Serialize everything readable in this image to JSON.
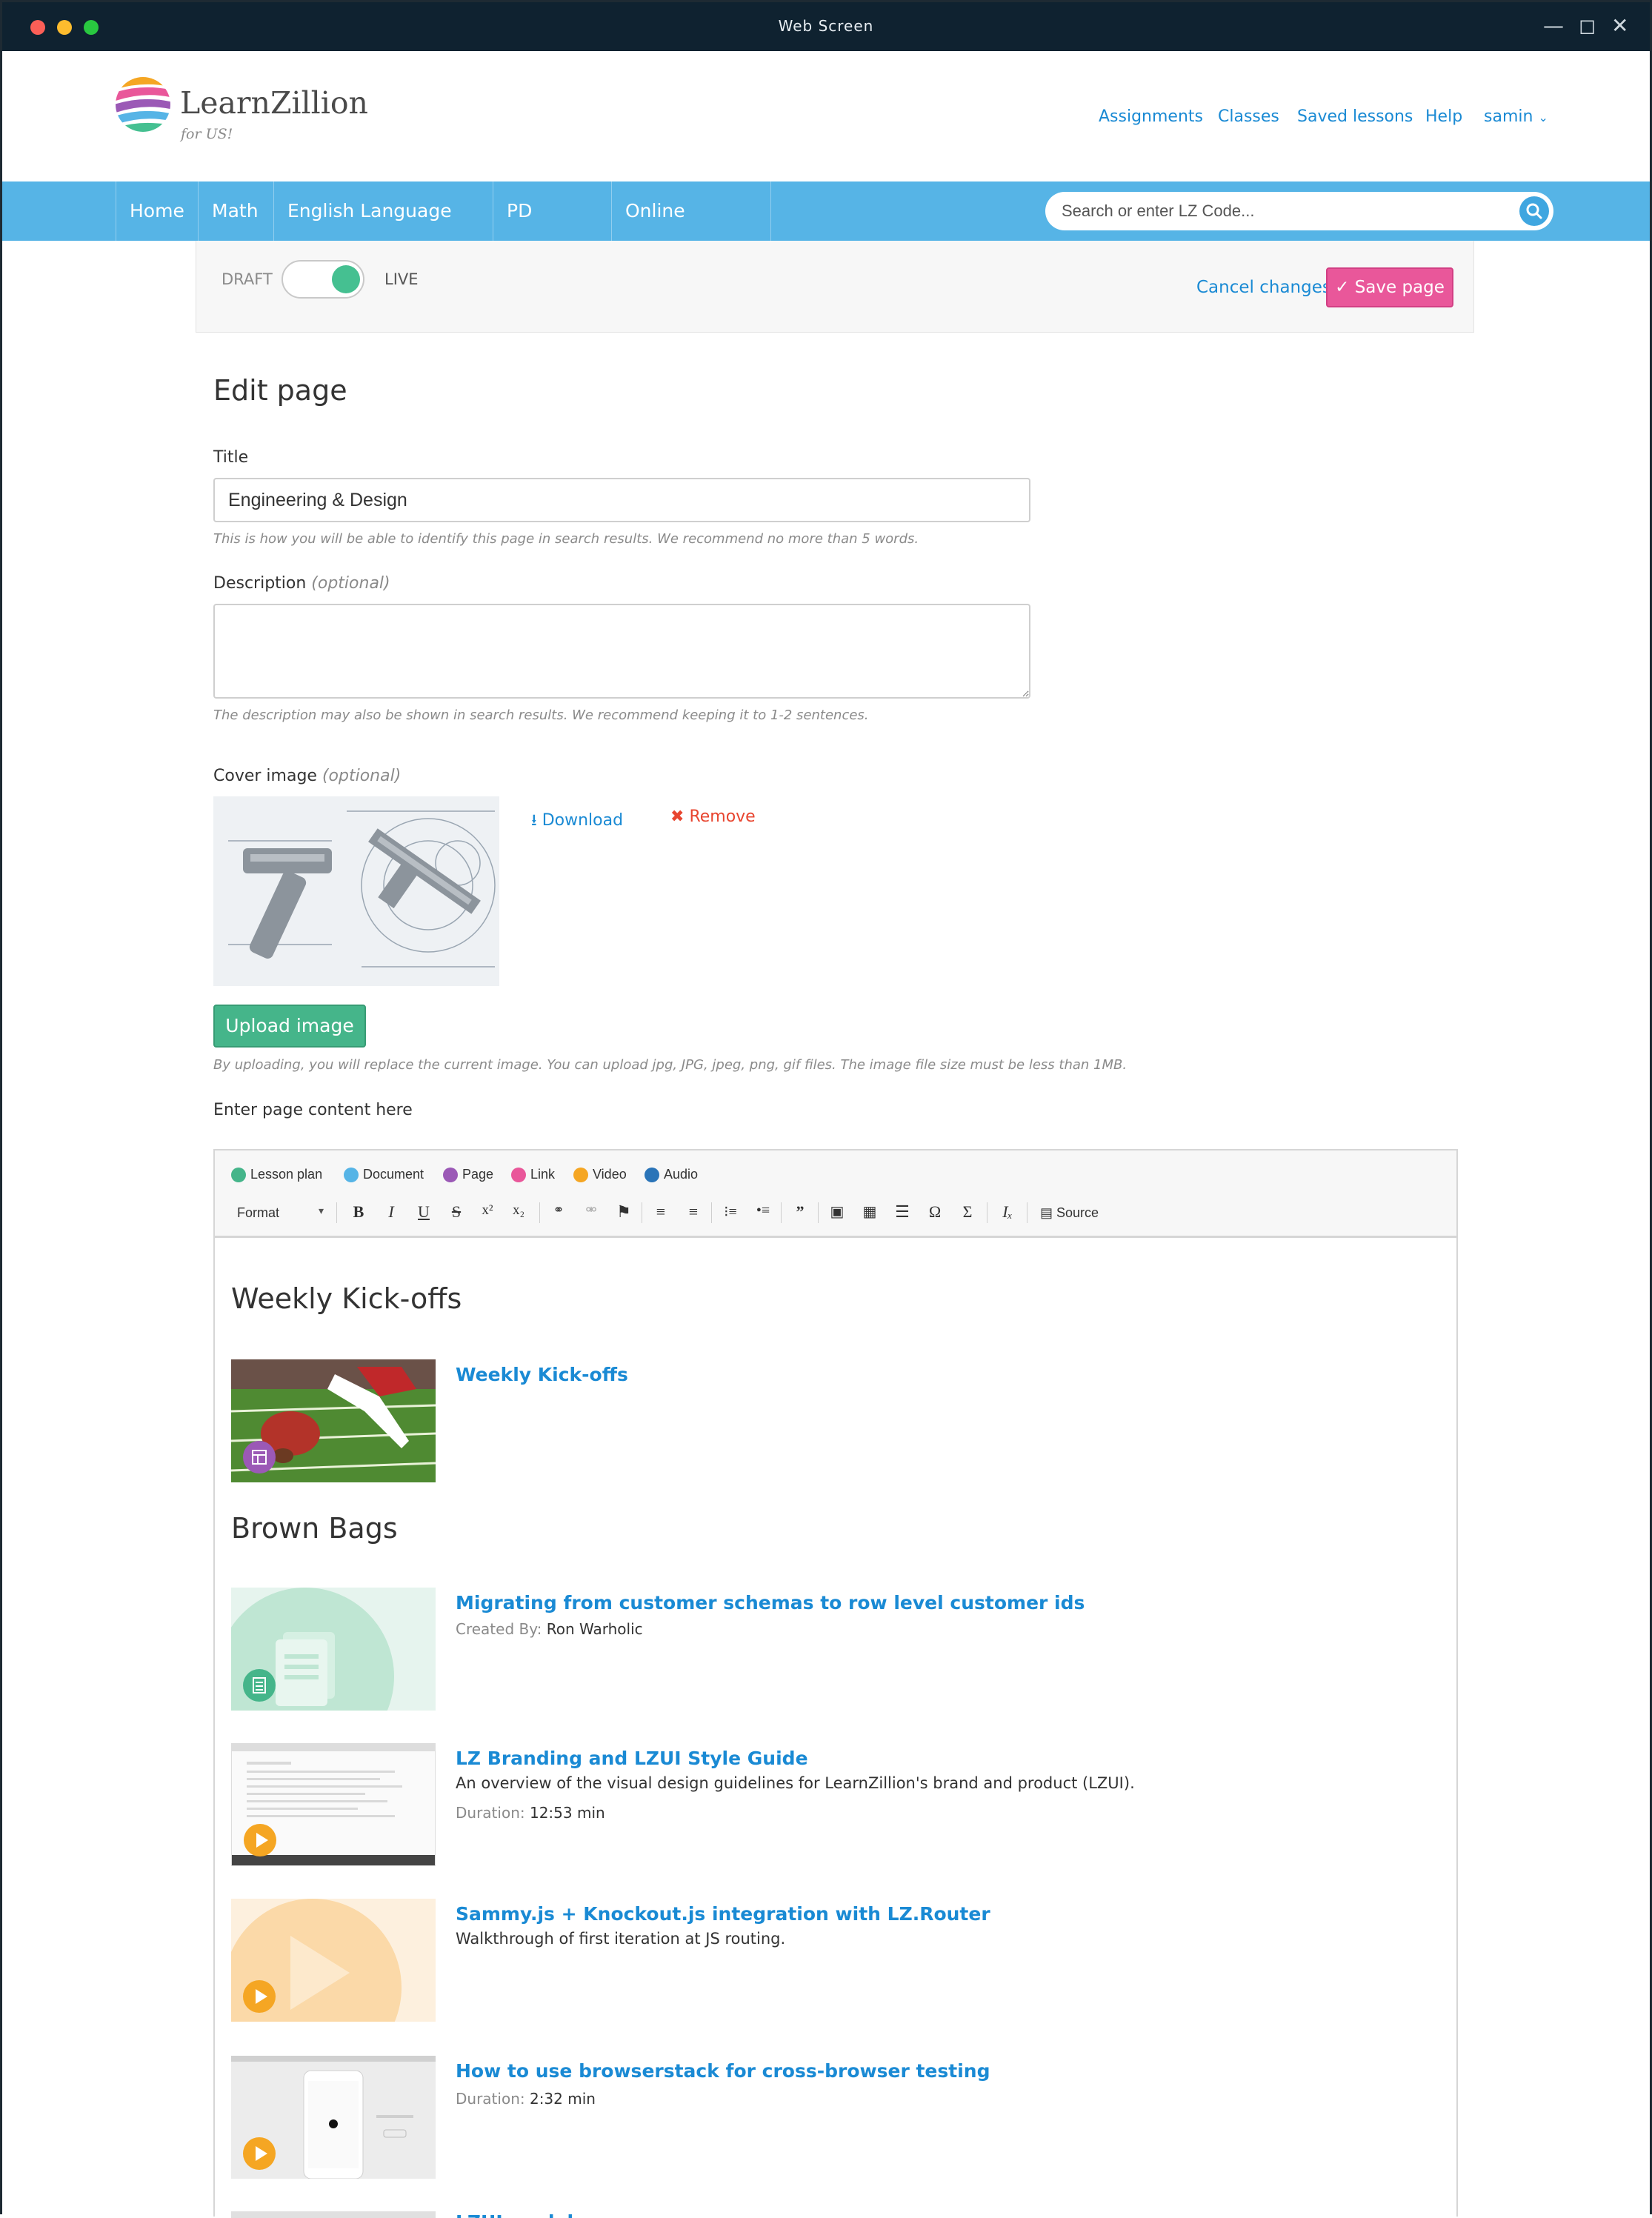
{
  "window": {
    "title": "Web Screen"
  },
  "brand": {
    "name": "LearnZillion",
    "tagline": "for US!"
  },
  "topnav": {
    "assignments": "Assignments",
    "classes": "Classes",
    "saved": "Saved lessons",
    "help": "Help",
    "user": "samin"
  },
  "mainnav": {
    "home": "Home",
    "math": "Math",
    "ela": "English Language Arts",
    "pd": "PD Library",
    "practice": "Online practice"
  },
  "search": {
    "placeholder": "Search or enter LZ Code..."
  },
  "publish": {
    "draft": "DRAFT",
    "live": "LIVE",
    "cancel": "Cancel changes",
    "save": "Save page",
    "is_live": true
  },
  "form": {
    "heading": "Edit page",
    "title_label": "Title",
    "title_value": "Engineering & Design",
    "title_hint": "This is how you will be able to identify this page in search results. We recommend no more than 5 words.",
    "desc_label": "Description",
    "optional": "(optional)",
    "desc_value": "",
    "desc_hint": "The description may also be shown in search results. We recommend keeping it to 1-2 sentences.",
    "cover_label": "Cover image",
    "download": "Download",
    "remove": "Remove",
    "upload": "Upload image",
    "upload_hint": "By uploading, you will replace the current image. You can upload jpg, JPG, jpeg, png, gif files. The image file size must be less than 1MB.",
    "content_label": "Enter page content here"
  },
  "editor": {
    "insert": {
      "lesson_plan": "Lesson plan",
      "document": "Document",
      "page": "Page",
      "link": "Link",
      "video": "Video",
      "audio": "Audio"
    },
    "format": "Format",
    "source": "Source",
    "colors": {
      "lesson": "#45b58a",
      "document": "#56b4e6",
      "page": "#9b59b6",
      "link": "#e9579a",
      "video": "#f5a623",
      "audio": "#2a74b8"
    }
  },
  "content": {
    "section1": "Weekly Kick-offs",
    "item1": {
      "title": "Weekly Kick-offs"
    },
    "section2": "Brown Bags",
    "item2": {
      "title": "Migrating from customer schemas to row level customer ids",
      "meta_label": "Created By:",
      "meta_value": "Ron Warholic"
    },
    "item3": {
      "title": "LZ Branding and LZUI Style Guide",
      "desc": "An overview of the visual design guidelines for LearnZillion's brand and product (LZUI).",
      "meta_label": "Duration:",
      "meta_value": "12:53 min"
    },
    "item4": {
      "title": "Sammy.js + Knockout.js integration with LZ.Router",
      "desc": "Walkthrough of first iteration at JS routing."
    },
    "item5": {
      "title": "How to use browserstack for cross-browser testing",
      "meta_label": "Duration:",
      "meta_value": "2:32 min"
    },
    "item6": {
      "title": "LZUI models"
    }
  }
}
